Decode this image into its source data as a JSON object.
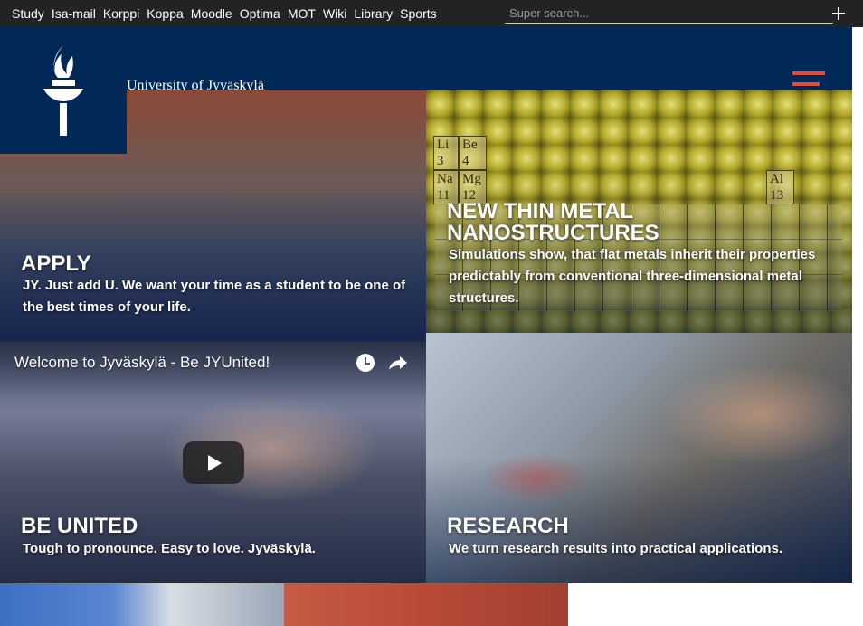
{
  "topnav": {
    "links": [
      "Study",
      "Isa-mail",
      "Korppi",
      "Koppa",
      "Moodle",
      "Optima",
      "MOT",
      "Wiki",
      "Library",
      "Sports"
    ],
    "search_placeholder": "Super search..."
  },
  "header": {
    "university_name": "University of Jyväskylä"
  },
  "tiles": {
    "apply": {
      "heading": "APPLY",
      "text": "JY. Just add U. We want your time as a student to be one of the best times of your life."
    },
    "metal": {
      "heading_line1": "NEW THIN METAL",
      "heading_line2": "NANOSTRUCTURES",
      "text": "Simulations show, that flat metals inherit their properties predictably from conventional three-dimensional metal structures."
    },
    "video": {
      "title": "Welcome to Jyväskylä - Be JYUnited!",
      "heading": "BE UNITED",
      "text": "Tough to pronounce. Easy to love. Jyväskylä."
    },
    "research": {
      "heading": "RESEARCH",
      "text": "We turn research results into practical applications."
    }
  },
  "periodic_cells": [
    {
      "symbol": "Li",
      "number": "3"
    },
    {
      "symbol": "Be",
      "number": "4"
    },
    {
      "symbol": "Na",
      "number": "11"
    },
    {
      "symbol": "Mg",
      "number": "12"
    },
    {
      "symbol": "Al",
      "number": "13"
    }
  ],
  "colors": {
    "brand_navy": "#002957",
    "topbar": "#232323",
    "menu_accent": "#e24a3c"
  }
}
